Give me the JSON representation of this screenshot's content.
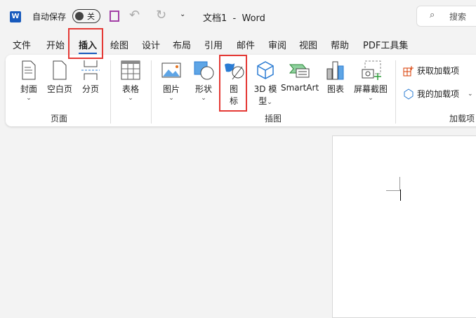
{
  "titlebar": {
    "autosave_label": "自动保存",
    "toggle_state": "关",
    "doc_title": "文档1  -  Word",
    "search_placeholder": "搜索"
  },
  "tabs": [
    "文件",
    "开始",
    "插入",
    "绘图",
    "设计",
    "布局",
    "引用",
    "邮件",
    "审阅",
    "视图",
    "帮助",
    "PDF工具集"
  ],
  "active_tab": "插入",
  "ribbon": {
    "pages": {
      "items": [
        "封面",
        "空白页",
        "分页"
      ],
      "label": "页面"
    },
    "tables": {
      "item": "表格"
    },
    "illustrations": {
      "picture": "图片",
      "shapes": "形状",
      "icons_1": "图",
      "icons_2": "标",
      "model_1": "3D 模",
      "model_2": "型",
      "smartart": "SmartArt",
      "chart": "图表",
      "screenshot": "屏幕截图",
      "label": "插图"
    },
    "addins": {
      "get": "获取加载项",
      "mine": "我的加载项",
      "label": "加载项"
    }
  }
}
